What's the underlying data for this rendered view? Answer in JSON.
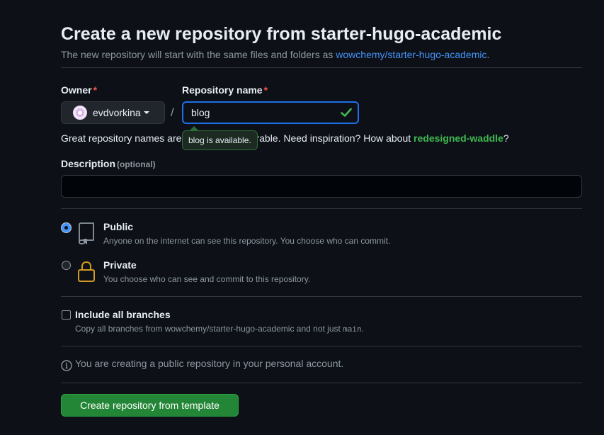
{
  "header": {
    "title": "Create a new repository from starter-hugo-academic",
    "subtitle_prefix": "The new repository will start with the same files and folders as ",
    "template_link": "wowchemy/starter-hugo-academic",
    "subtitle_suffix": "."
  },
  "owner": {
    "label": "Owner",
    "required_mark": "*",
    "value": "evdvorkina"
  },
  "separator": "/",
  "repo_name": {
    "label": "Repository name",
    "required_mark": "*",
    "value": "blog",
    "tooltip": "blog is available."
  },
  "hint": {
    "prefix": "Great repository names are short and memorable. Need inspiration? How about ",
    "suggestion": "redesigned-waddle",
    "suffix": "?"
  },
  "description": {
    "label": "Description",
    "optional": "(optional)",
    "value": ""
  },
  "visibility": {
    "public_title": "Public",
    "public_desc": "Anyone on the internet can see this repository. You choose who can commit.",
    "private_title": "Private",
    "private_desc": "You choose who can see and commit to this repository.",
    "selected": "public"
  },
  "branches": {
    "label": "Include all branches",
    "desc_prefix": "Copy all branches from wowchemy/starter-hugo-academic and not just ",
    "desc_code": "main",
    "desc_suffix": ".",
    "checked": false
  },
  "info": {
    "text": "You are creating a public repository in your personal account."
  },
  "submit": {
    "label": "Create repository from template"
  },
  "colors": {
    "accent": "#4493f8",
    "success": "#3fb950",
    "button": "#238636",
    "required": "#f85149",
    "private_lock": "#d29922"
  }
}
